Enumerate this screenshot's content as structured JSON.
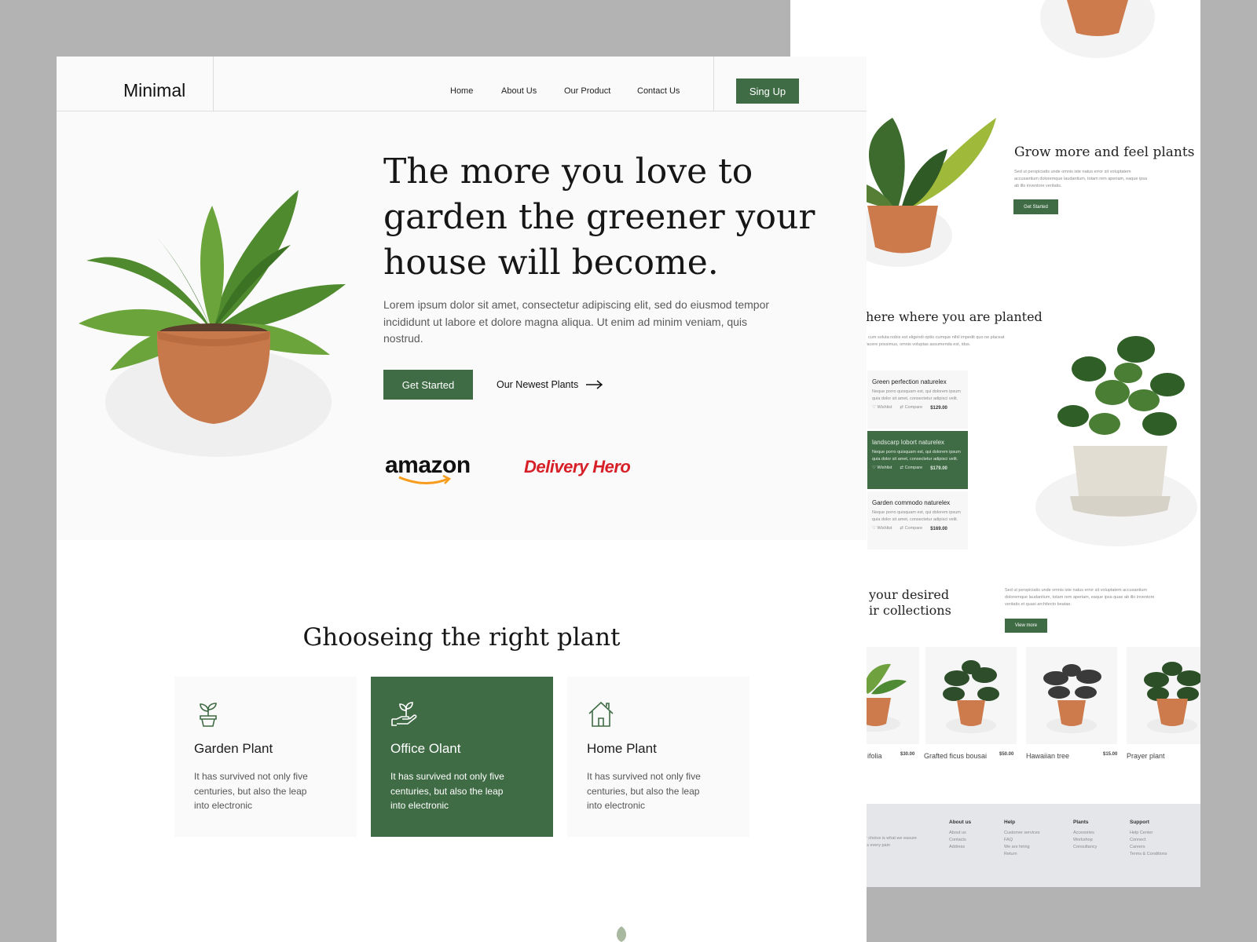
{
  "colors": {
    "brand_green": "#3f6b45",
    "background": "#b3b3b3",
    "delivery_hero_red": "#d61f26",
    "amazon_orange": "#f79c1c"
  },
  "front": {
    "brand": "Minimal",
    "nav": {
      "home": "Home",
      "about": "About Us",
      "product": "Our Product",
      "contact": "Contact Us"
    },
    "signup_label": "Sing Up",
    "hero": {
      "title_line1": "The more you love to",
      "title_line2": "garden the greener your",
      "title_line3": "house will become.",
      "description": "Lorem ipsum dolor sit amet, consectetur adipiscing elit, sed do eiusmod tempor incididunt ut labore et dolore magna aliqua. Ut enim ad minim veniam, quis nostrud.",
      "cta_label": "Get Started",
      "newest_label": "Our Newest Plants",
      "partners": [
        "amazon",
        "Delivery Hero"
      ]
    },
    "choosing": {
      "title": "Ghooseing the  right plant",
      "cards": [
        {
          "icon": "sprout-pot-icon",
          "title": "Garden Plant",
          "desc": "It has survived not only five centuries, but also the leap into electronic"
        },
        {
          "icon": "hand-plant-icon",
          "title": "Office Olant",
          "desc": "It has survived not only five centuries, but also the leap into electronic"
        },
        {
          "icon": "house-icon",
          "title": "Home Plant",
          "desc": "It has survived not only five centuries, but also the leap into electronic"
        }
      ]
    }
  },
  "back": {
    "grow": {
      "title": "Grow more and feel plants",
      "desc": "Sed ut perspiciatis unde omnis iste natus error sit voluptatem accusantium doloremque laudantium, totam rem aperiam, eaque ipsa ab illo inventore veritatis.",
      "button": "Get Started"
    },
    "planted": {
      "title": "here where you are planted",
      "desc": ", cum soluta nobis est eligendi optio cumque nihil impedit quo ne placeat facere possimus, omnis voluptas assumenda est, idus.",
      "items": [
        {
          "title": "Green perfection naturelex",
          "desc": "Neque porro quisquam est, qui dolorem ipsum quia dolor sit amet, consectetur adipisci velit.",
          "wishlist": "Wishlist",
          "compare": "Compare",
          "price": "$129.00"
        },
        {
          "title": "landscarp lobort naturelex",
          "desc": "Neque porro quisquam est, qui dolorem ipsum quia dolor sit amet, consectetur adipisci velit.",
          "wishlist": "Wishlist",
          "compare": "Compare",
          "price": "$179.00"
        },
        {
          "title": "Garden commodo naturelex",
          "desc": "Neque porro quisquam est, qui dolorem ipsum quia dolor sit amet, consectetur adipisci velit.",
          "wishlist": "Wishlist",
          "compare": "Compare",
          "price": "$169.00"
        }
      ]
    },
    "collections": {
      "title_line1": "your desired",
      "title_line2": "ir collections",
      "desc": "Sed ut perspiciatis unde omnis iste natus error sit voluptatem accusantium doloremque laudantium, totam rem aperiam, eaque ipsa quae ab illo inventore veritatis et quasi architecto beatae.",
      "button": "View more"
    },
    "products": [
      {
        "name": "ifolia",
        "price": "$30.00"
      },
      {
        "name": "Grafted ficus bousai",
        "price": "$50.00"
      },
      {
        "name": "Hawaiian tree",
        "price": "$15.00"
      },
      {
        "name": "Prayer plant",
        "price": ""
      }
    ],
    "footer": {
      "tagline": "r choice is what we easure is every pain",
      "columns": [
        {
          "heading": "About us",
          "links": [
            "About us",
            "Contacts",
            "Address"
          ]
        },
        {
          "heading": "Help",
          "links": [
            "Customer services",
            "FAQ",
            "We are hiring",
            "Return"
          ]
        },
        {
          "heading": "Plants",
          "links": [
            "Accesories",
            "Workshop",
            "Consultancy"
          ]
        },
        {
          "heading": "Support",
          "links": [
            "Help Center",
            "Connect",
            "Careers",
            "Terms & Conditions"
          ]
        }
      ]
    }
  }
}
